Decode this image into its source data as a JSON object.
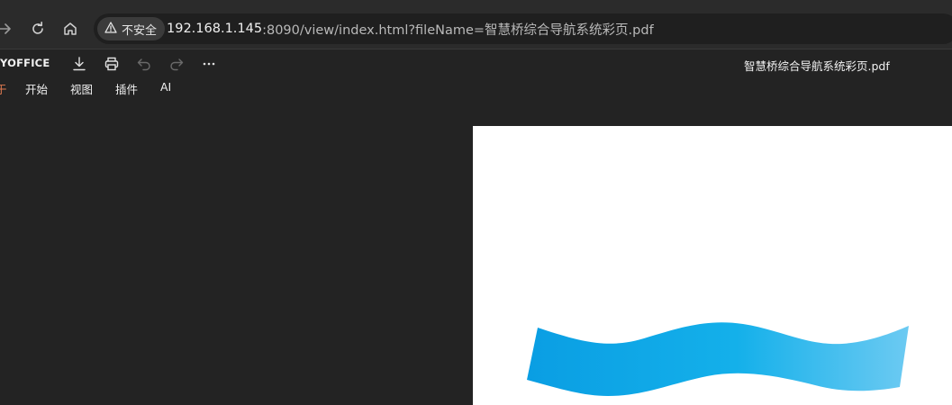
{
  "browser": {
    "security_label": "不安全",
    "url_host": "192.168.1.145",
    "url_rest": ":8090/view/index.html?fileName=智慧桥综合导航系统彩页.pdf",
    "icons": [
      "forward-icon",
      "reload-icon",
      "home-icon",
      "warning-icon"
    ]
  },
  "toolbar": {
    "brand": "YOFFICE",
    "doc_title": "智慧桥综合导航系统彩页.pdf",
    "icons": [
      "download-icon",
      "print-icon",
      "undo-icon",
      "redo-icon",
      "more-icon"
    ]
  },
  "menu": {
    "partial": "于",
    "items": [
      "开始",
      "视图",
      "插件",
      "AI"
    ]
  },
  "colors": {
    "browser_bg": "#2b2b2b",
    "address_bg": "#1f1f1f",
    "app_bg": "#232323",
    "wave_start": "#0a9ee3",
    "wave_end": "#6ccaf2"
  }
}
